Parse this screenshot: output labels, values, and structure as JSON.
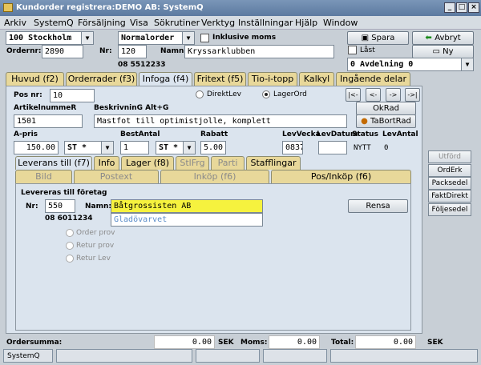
{
  "window": {
    "title": "Kundorder registrera:DEMO AB: SystemQ",
    "minimize": "_",
    "restore": "□",
    "close": "×"
  },
  "menu": [
    "Arkiv",
    "SystemQ",
    "Försäljning",
    "Visa",
    "Sökrutiner",
    "Verktyg",
    "Inställningar",
    "Hjälp",
    "Window"
  ],
  "header": {
    "customer_combo": "100  Stockholm",
    "order_type_combo": "Normalorder",
    "inkl_moms_label": "Inklusive moms",
    "ordernr_label": "Ordernr:",
    "ordernr_value": "2890",
    "nr_label": "Nr:",
    "nr_value": "120",
    "namn_label": "Namn:",
    "namn_value": "Kryssarklubben",
    "phone": "08 5512233",
    "spara": "Spara",
    "avbryt": "Avbryt",
    "last_label": "Låst",
    "ny": "Ny",
    "avdelning_combo": "0  Avdelning 0"
  },
  "tabs": [
    "Huvud (f2)",
    "Orderrader (f3)",
    "Infoga (f4)",
    "Fritext (f5)",
    "Tio-i-topp",
    "Kalkyl",
    "Ingående delar"
  ],
  "infoga": {
    "posnr_label": "Pos nr:",
    "posnr_value": "10",
    "direktlev": "DirektLev",
    "lagerord": "LagerOrd",
    "nav": [
      "|<-",
      "<-",
      "->",
      "->|"
    ],
    "artikel_label": "ArtikelnummeR",
    "artikel_value": "1501",
    "beskr_label": "BeskrivninG Alt+G",
    "beskr_value": "Mastfot till optimistjolle, komplett",
    "okrad": "OkRad",
    "tabortrad": "TaBortRad",
    "apris_label": "A-pris",
    "apris_value": "150.00",
    "unit1": "ST *",
    "bestantal_label": "BestAntal",
    "bestantal_value": "1",
    "unit2": "ST *",
    "rabatt_label": "Rabatt",
    "rabatt_value": "5.00",
    "levvecka_label": "LevVecka",
    "levvecka_value": "0837",
    "levdatum_label": "LevDatum",
    "levdatum_value": "",
    "status_label": "Status",
    "status_value": "NYTT",
    "levantal_label": "LevAntal",
    "levantal_value": "0"
  },
  "subtabs": [
    "Leverans till (f7)",
    "Info",
    "Lager (f8)",
    "StlFrg",
    "Parti",
    "Stafflingar"
  ],
  "subtabs2": [
    "Bild",
    "Postext",
    "Inköp (f6)",
    "Pos/Inköp (f6)"
  ],
  "leverans": {
    "title": "Levereras till företag",
    "nr_label": "Nr:",
    "nr_value": "550",
    "namn_label": "Namn:",
    "namn_value": "Båtgrossisten AB",
    "namn2_value": "Gladövarvet",
    "phone": "08 6011234",
    "rensa": "Rensa",
    "radios": [
      "Order prov",
      "Retur prov",
      "Retur Lev"
    ]
  },
  "side_buttons": [
    "Utförd",
    "OrdErk",
    "Packsedel",
    "FaktDirekt",
    "Följesedel"
  ],
  "totals": {
    "ordersumma_label": "Ordersumma:",
    "ordersumma_value": "0.00",
    "sek1": "SEK",
    "moms_label": "Moms:",
    "moms_value": "0.00",
    "total_label": "Total:",
    "total_value": "0.00",
    "sek2": "SEK"
  },
  "statusbar": [
    "SystemQ"
  ]
}
